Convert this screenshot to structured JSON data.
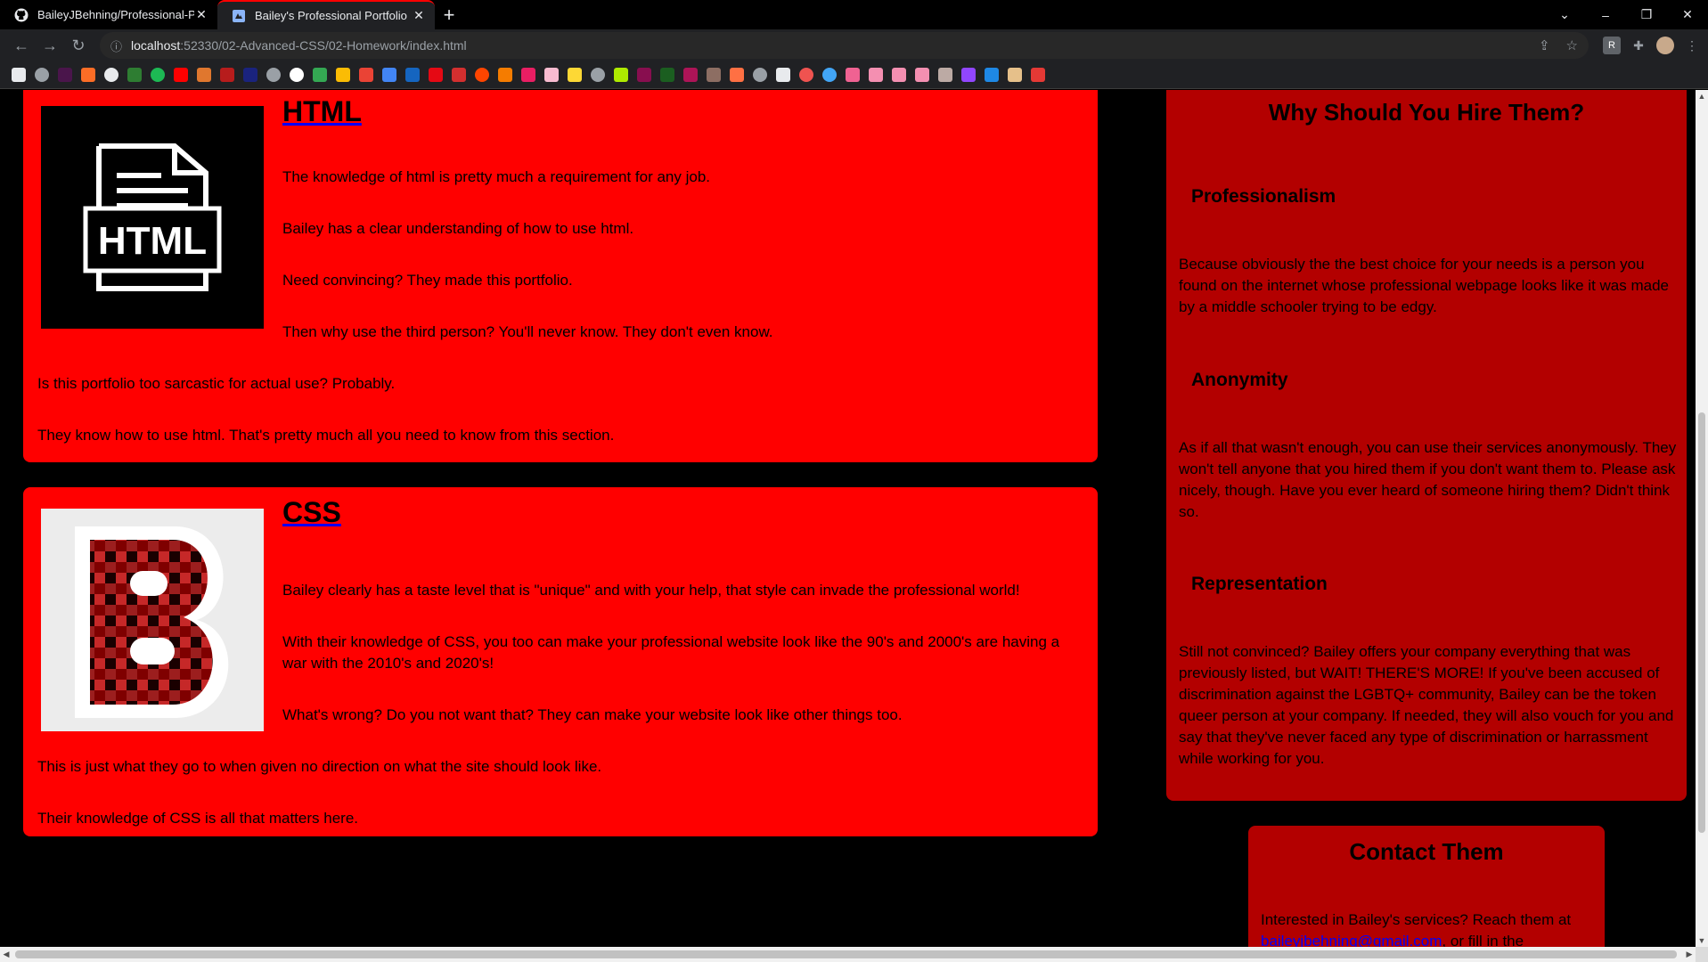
{
  "browser": {
    "tabs": [
      {
        "title": "BaileyJBehning/Professional-Port",
        "icon": "github-icon"
      },
      {
        "title": "Bailey's Professional Portfolio",
        "icon": "site-icon"
      }
    ],
    "url_host": "localhost",
    "url_path": ":52330/02-Advanced-CSS/02-Homework/index.html"
  },
  "html_section": {
    "heading": "HTML",
    "p1": "The knowledge of html is pretty much a requirement for any job.",
    "p2": "Bailey has a clear understanding of how to use html.",
    "p3": "Need convincing? They made this portfolio.",
    "p4": "Then why use the third person? You'll never know. They don't even know.",
    "p5": "Is this portfolio too sarcastic for actual use? Probably.",
    "p6": "They know how to use html. That's pretty much all you need to know from this section.",
    "icon_label": "HTML"
  },
  "css_section": {
    "heading": "CSS",
    "p1": "Bailey clearly has a taste level that is \"unique\" and with your help, that style can invade the professional world!",
    "p2": "With their knowledge of CSS, you too can make your professional website look like the 90's and 2000's are having a war with the 2010's and 2020's!",
    "p3": "What's wrong? Do you not want that? They can make your website look like other things too.",
    "p4": "This is just what they go to when given no direction on what the site should look like.",
    "p5": "Their knowledge of CSS is all that matters here."
  },
  "aside": {
    "title": "Why Should You Hire Them?",
    "h1": "Professionalism",
    "t1": "Because obviously the the best choice for your needs is a person you found on the internet whose professional webpage looks like it was made by a middle schooler trying to be edgy.",
    "h2": "Anonymity",
    "t2": "As if all that wasn't enough, you can use their services anonymously. They won't tell anyone that you hired them if you don't want them to. Please ask nicely, though. Have you ever heard of someone hiring them? Didn't think so.",
    "h3": "Representation",
    "t3": "Still not convinced? Bailey offers your company everything that was previously listed, but WAIT! THERE'S MORE! If you've been accused of discrimination against the LGBTQ+ community, Bailey can be the token queer person at your company. If needed, they will also vouch for you and say that they've never faced any type of discrimination or harrassment while working for you."
  },
  "contact": {
    "title": "Contact Them",
    "text_before": "Interested in Bailey's services? Reach them at",
    "email": "baileyjbehning@gmail.com",
    "text_after": ", or fill in the"
  }
}
